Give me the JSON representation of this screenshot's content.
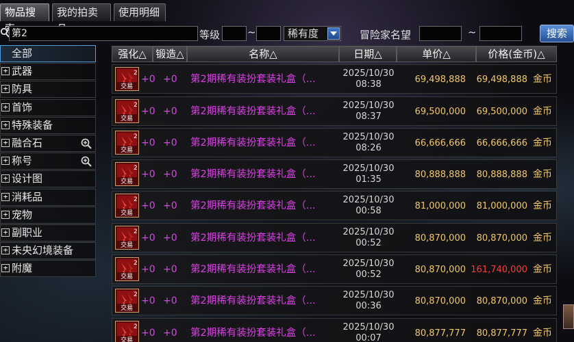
{
  "tabs": [
    {
      "label": "物品搜索",
      "active": true
    },
    {
      "label": "我的拍卖品",
      "active": false
    },
    {
      "label": "使用明细",
      "active": false
    }
  ],
  "search": {
    "value": "第2",
    "grade_label": "等级",
    "grade_min": "",
    "grade_max": "",
    "range_sep": "~",
    "rarity_value": "稀有度",
    "adventurer_label": "冒险家名望",
    "adv_min": "",
    "adv_max": "",
    "button_label": "搜索"
  },
  "sidebar": {
    "items": [
      {
        "label": "全部",
        "expandable": false,
        "active": true,
        "zoom": false
      },
      {
        "label": "武器",
        "expandable": true,
        "active": false,
        "zoom": false
      },
      {
        "label": "防具",
        "expandable": true,
        "active": false,
        "zoom": false
      },
      {
        "label": "首饰",
        "expandable": true,
        "active": false,
        "zoom": false
      },
      {
        "label": "特殊装备",
        "expandable": true,
        "active": false,
        "zoom": false
      },
      {
        "label": "融合石",
        "expandable": true,
        "active": false,
        "zoom": true
      },
      {
        "label": "称号",
        "expandable": true,
        "active": false,
        "zoom": true
      },
      {
        "label": "设计图",
        "expandable": true,
        "active": false,
        "zoom": false
      },
      {
        "label": "消耗品",
        "expandable": true,
        "active": false,
        "zoom": false
      },
      {
        "label": "宠物",
        "expandable": true,
        "active": false,
        "zoom": false
      },
      {
        "label": "副职业",
        "expandable": true,
        "active": false,
        "zoom": false
      },
      {
        "label": "未央幻境装备",
        "expandable": true,
        "active": false,
        "zoom": false
      },
      {
        "label": "附魔",
        "expandable": true,
        "active": false,
        "zoom": false
      }
    ],
    "plus_glyph": "+"
  },
  "table": {
    "headers": [
      "强化△",
      "锻造△",
      "名称△",
      "日期△",
      "单价△",
      "价格(金币)△"
    ],
    "icon_badge": "2",
    "icon_text": "交易",
    "gold_label": "金币",
    "rows": [
      {
        "enhance": "+0",
        "forge": "+0",
        "name": "第2期稀有装扮套装礼盒（...",
        "date": "2025/10/30",
        "time": "08:38",
        "unit_price": "69,498,888",
        "total": "69,498,888",
        "highlight": false
      },
      {
        "enhance": "+0",
        "forge": "+0",
        "name": "第2期稀有装扮套装礼盒（...",
        "date": "2025/10/30",
        "time": "08:37",
        "unit_price": "69,500,000",
        "total": "69,500,000",
        "highlight": false
      },
      {
        "enhance": "+0",
        "forge": "+0",
        "name": "第2期稀有装扮套装礼盒（...",
        "date": "2025/10/30",
        "time": "08:26",
        "unit_price": "66,666,666",
        "total": "66,666,666",
        "highlight": false
      },
      {
        "enhance": "+0",
        "forge": "+0",
        "name": "第2期稀有装扮套装礼盒（...",
        "date": "2025/10/30",
        "time": "01:35",
        "unit_price": "80,888,888",
        "total": "80,888,888",
        "highlight": false
      },
      {
        "enhance": "+0",
        "forge": "+0",
        "name": "第2期稀有装扮套装礼盒（...",
        "date": "2025/10/30",
        "time": "00:58",
        "unit_price": "81,000,000",
        "total": "81,000,000",
        "highlight": false
      },
      {
        "enhance": "+0",
        "forge": "+0",
        "name": "第2期稀有装扮套装礼盒（...",
        "date": "2025/10/30",
        "time": "00:52",
        "unit_price": "80,870,000",
        "total": "80,870,000",
        "highlight": false
      },
      {
        "enhance": "+0",
        "forge": "+0",
        "name": "第2期稀有装扮套装礼盒（...",
        "date": "2025/10/30",
        "time": "00:52",
        "unit_price": "80,870,000",
        "total": "161,740,000",
        "highlight": true
      },
      {
        "enhance": "+0",
        "forge": "+0",
        "name": "第2期稀有装扮套装礼盒（...",
        "date": "2025/10/30",
        "time": "00:36",
        "unit_price": "80,870,000",
        "total": "80,870,000",
        "highlight": false
      },
      {
        "enhance": "+0",
        "forge": "+0",
        "name": "第2期稀有装扮套装礼盒（...",
        "date": "2025/10/30",
        "time": "00:07",
        "unit_price": "80,877,777",
        "total": "80,877,777",
        "highlight": false
      }
    ]
  },
  "colors": {
    "accent_blue": "#3f76c8",
    "price_gold": "#f3c86a",
    "highlight_red": "#ff3a3a",
    "item_name_purple": "#dd40e8"
  }
}
